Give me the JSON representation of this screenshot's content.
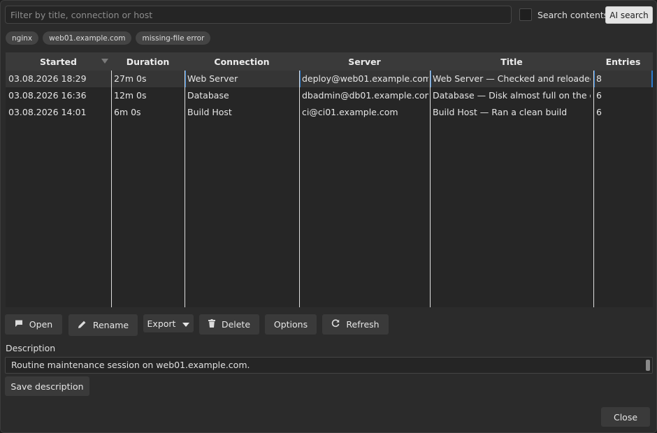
{
  "filter": {
    "placeholder": "Filter by title, connection or host",
    "value": ""
  },
  "search_contents": {
    "label": "Search contents",
    "checked": false
  },
  "ai_search_label": "AI search",
  "tags": [
    "nginx",
    "web01.example.com",
    "missing-file error"
  ],
  "table": {
    "columns": [
      "Started",
      "Duration",
      "Connection",
      "Server",
      "Title",
      "Entries"
    ],
    "sort_column": "Started",
    "rows": [
      {
        "started": "03.08.2026 18:29",
        "duration": "27m 0s",
        "connection": "Web Server",
        "server": "deploy@web01.example.com",
        "title": "Web Server — Checked and reloaded n...",
        "entries": "8",
        "selected": true
      },
      {
        "started": "03.08.2026 16:36",
        "duration": "12m 0s",
        "connection": "Database",
        "server": "dbadmin@db01.example.com",
        "title": "Database — Disk almost full on the data ...",
        "entries": "6",
        "selected": false
      },
      {
        "started": "03.08.2026 14:01",
        "duration": "6m 0s",
        "connection": "Build Host",
        "server": "ci@ci01.example.com",
        "title": "Build Host — Ran a clean build",
        "entries": "6",
        "selected": false
      }
    ]
  },
  "toolbar": {
    "open": "Open",
    "rename": "Rename",
    "export": "Export",
    "delete": "Delete",
    "options": "Options",
    "refresh": "Refresh"
  },
  "description": {
    "label": "Description",
    "value": "Routine maintenance session on web01.example.com."
  },
  "save_description": "Save description",
  "close": "Close",
  "colors": {
    "background": "#2b2b2b",
    "header": "#3a3a3a",
    "selection_marker": "#2c7ccf",
    "ai_button": "#e5e5e5"
  }
}
